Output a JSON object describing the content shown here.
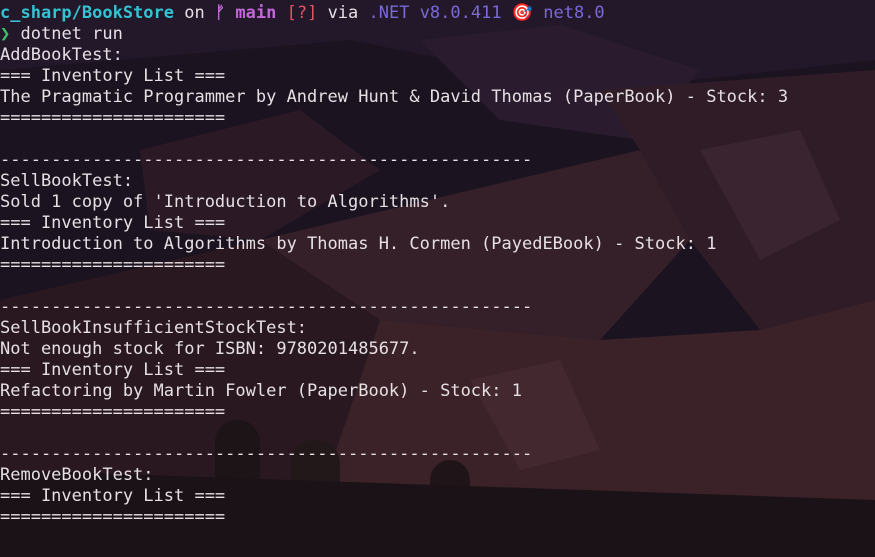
{
  "prompt": {
    "path": "c_sharp/BookStore",
    "on": " on ",
    "branch_icon": "ᚠ",
    "branch": "main",
    "status": "[?]",
    "via": " via ",
    "dotnet": ".NET v8.0.411",
    "target_icon": "🎯",
    "target": "net8.0",
    "symbol": "❯",
    "command": "dotnet run"
  },
  "output": [
    "AddBookTest:",
    "=== Inventory List ===",
    "The Pragmatic Programmer by Andrew Hunt & David Thomas (PaperBook) - Stock: 3",
    "======================",
    "",
    "----------------------------------------------------",
    "SellBookTest:",
    "Sold 1 copy of 'Introduction to Algorithms'.",
    "=== Inventory List ===",
    "Introduction to Algorithms by Thomas H. Cormen (PayedEBook) - Stock: 1",
    "======================",
    "",
    "----------------------------------------------------",
    "SellBookInsufficientStockTest:",
    "Not enough stock for ISBN: 9780201485677.",
    "=== Inventory List ===",
    "Refactoring by Martin Fowler (PaperBook) - Stock: 1",
    "======================",
    "",
    "----------------------------------------------------",
    "RemoveBookTest:",
    "=== Inventory List ===",
    "======================"
  ],
  "colors": {
    "background": "#1b1420",
    "text": "#e6e0e4",
    "path": "#33c3d3",
    "branch": "#c467d8",
    "status": "#e0555f",
    "dotnet": "#7a69d8",
    "prompt_symbol": "#3ec26a"
  }
}
